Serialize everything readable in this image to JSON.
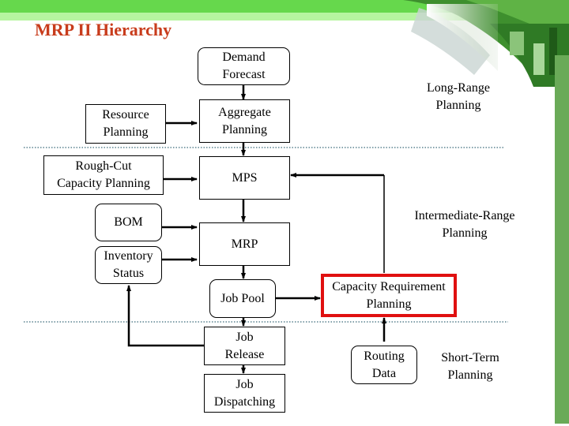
{
  "title": "MRP II Hierarchy",
  "colors": {
    "title": "#c83c1c",
    "header_green": "#66d84c",
    "header_light_green": "#b6f5a0",
    "side_bar_green": "#6aaa58",
    "highlight_red": "#e01010",
    "divider": "#3a6a7a"
  },
  "nodes": {
    "demand_forecast": "Demand\nForecast",
    "aggregate_planning": "Aggregate\nPlanning",
    "resource_planning": "Resource\nPlanning",
    "rough_cut": "Rough-Cut\nCapacity Planning",
    "mps": "MPS",
    "bom": "BOM",
    "inventory_status": "Inventory\nStatus",
    "mrp": "MRP",
    "job_pool": "Job Pool",
    "job_release": "Job\nRelease",
    "job_dispatching": "Job\nDispatching",
    "capacity_requirement_planning": "Capacity Requirement\nPlanning",
    "routing_data": "Routing\nData"
  },
  "horizons": {
    "long_range": "Long-Range\nPlanning",
    "intermediate_range": "Intermediate-Range\nPlanning",
    "short_term": "Short-Term\nPlanning"
  },
  "edges": [
    {
      "from": "demand_forecast",
      "to": "aggregate_planning"
    },
    {
      "from": "resource_planning",
      "to": "aggregate_planning"
    },
    {
      "from": "aggregate_planning",
      "to": "mps"
    },
    {
      "from": "rough_cut",
      "to": "mps"
    },
    {
      "from": "capacity_requirement_planning",
      "to": "mps"
    },
    {
      "from": "mps",
      "to": "mrp"
    },
    {
      "from": "bom",
      "to": "mrp"
    },
    {
      "from": "inventory_status",
      "to": "mrp"
    },
    {
      "from": "mrp",
      "to": "job_pool"
    },
    {
      "from": "job_pool",
      "to": "capacity_requirement_planning"
    },
    {
      "from": "job_pool",
      "to": "job_release"
    },
    {
      "from": "job_release",
      "to": "inventory_status"
    },
    {
      "from": "job_release",
      "to": "job_dispatching"
    },
    {
      "from": "routing_data",
      "to": "capacity_requirement_planning"
    }
  ]
}
